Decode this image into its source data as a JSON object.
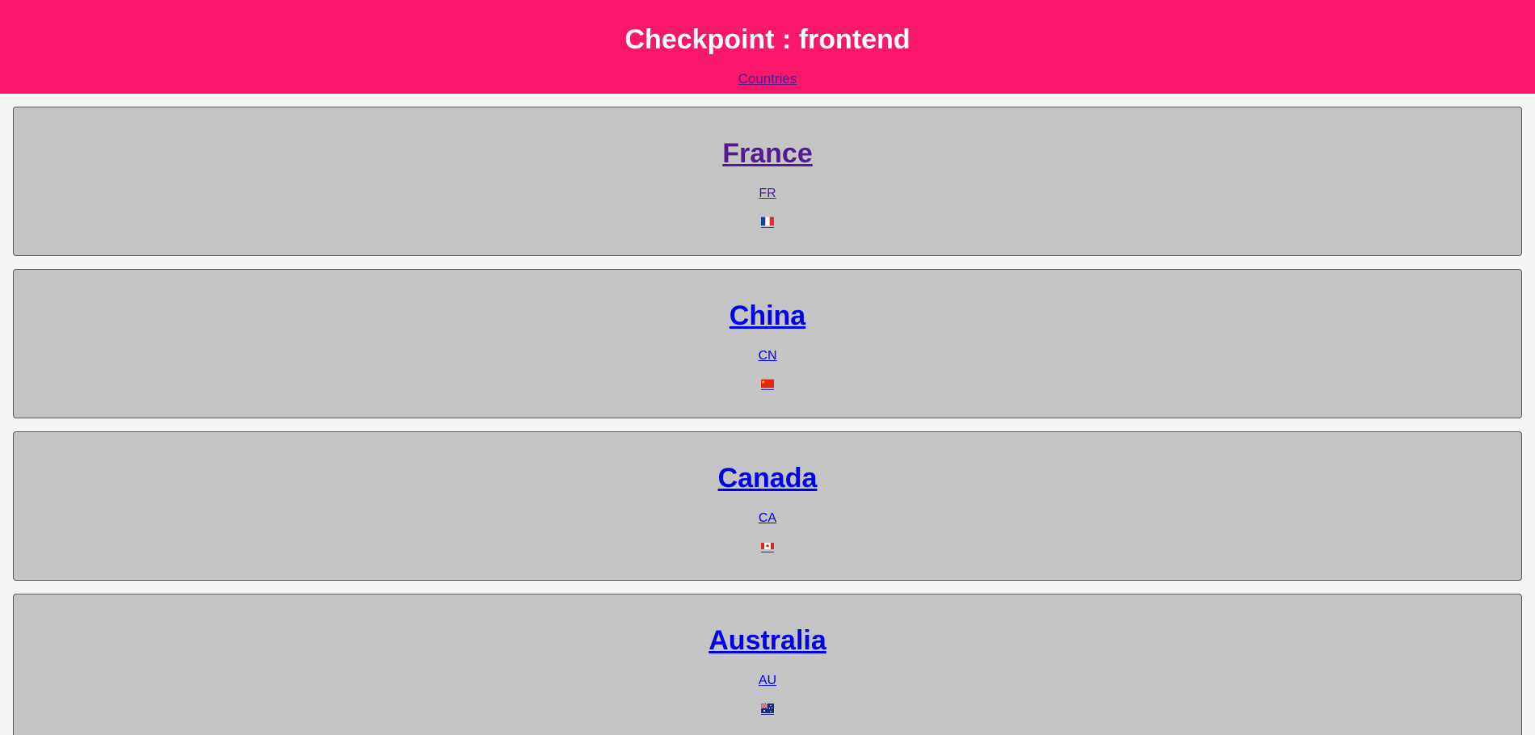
{
  "header": {
    "title": "Checkpoint : frontend",
    "nav_link": "Countries"
  },
  "countries": [
    {
      "name": "France",
      "code": "FR",
      "flag_icon": "france-flag-icon",
      "visited": true
    },
    {
      "name": "China",
      "code": "CN",
      "flag_icon": "china-flag-icon",
      "visited": false
    },
    {
      "name": "Canada",
      "code": "CA",
      "flag_icon": "canada-flag-icon",
      "visited": false
    },
    {
      "name": "Australia",
      "code": "AU",
      "flag_icon": "australia-flag-icon",
      "visited": false
    }
  ],
  "colors": {
    "header_bg": "#f8176b",
    "card_bg": "#c4c4c4",
    "visited_link": "#551a8b",
    "link": "#0000ee"
  }
}
